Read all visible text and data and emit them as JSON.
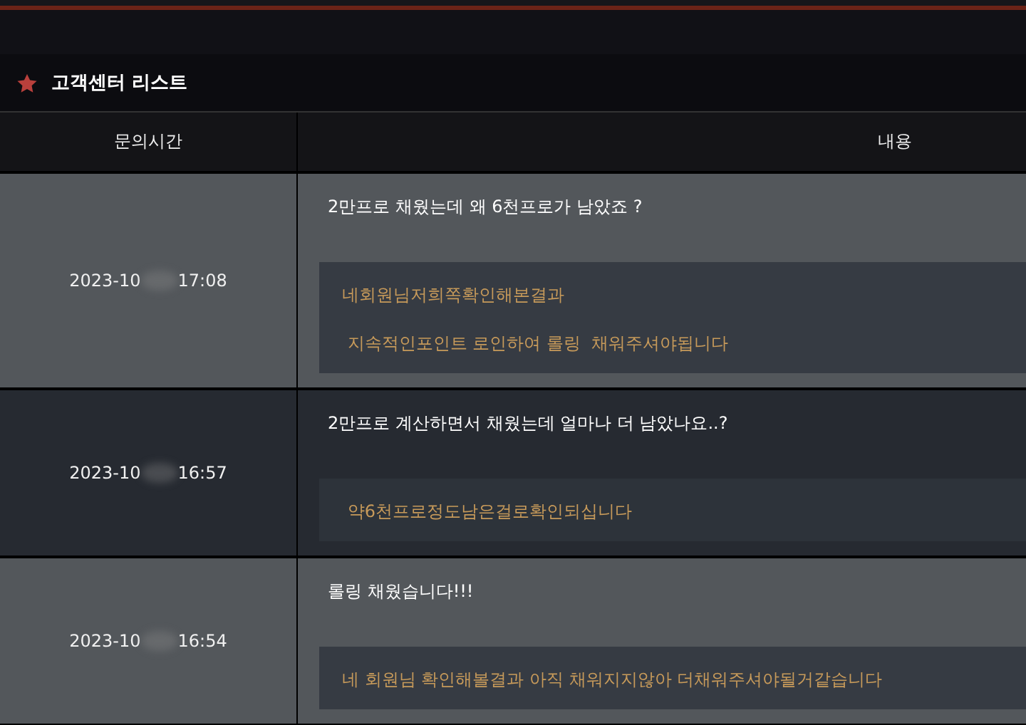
{
  "section": {
    "title": "고객센터 리스트"
  },
  "table": {
    "columns": [
      "문의시간",
      "내용"
    ],
    "rows": [
      {
        "date": "2023-10",
        "time": "17:08",
        "question": "2만프로 채웠는데 왜 6천프로가 남았죠 ?",
        "answers": [
          "네회원님저희쪽확인해본결과",
          " 지속적인포인트 로인하여 롤링  채워주셔야됩니다"
        ]
      },
      {
        "date": "2023-10",
        "time": "16:57",
        "question": "2만프로 계산하면서 채웠는데 얼마나 더 남았나요..?",
        "answers": [
          " 약6천프로정도남은걸로확인되십니다"
        ]
      },
      {
        "date": "2023-10",
        "time": "16:54",
        "question": "롤링 채웠습니다!!!",
        "answers": [
          "네 회원님 확인해볼결과 아직 채워지지않아 더채워주셔야될거같습니다"
        ]
      }
    ]
  }
}
